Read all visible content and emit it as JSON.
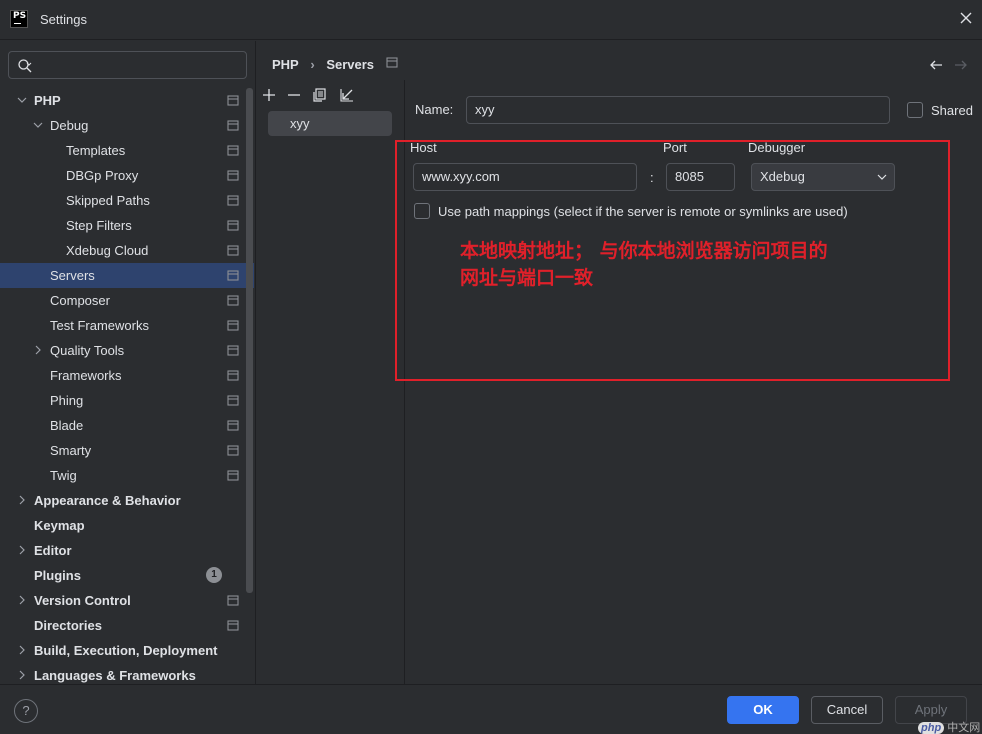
{
  "window": {
    "title": "Settings",
    "logo_text": "PS"
  },
  "search": {
    "placeholder": ""
  },
  "sidebar": {
    "items": [
      {
        "label": "PHP",
        "bold": true,
        "expanded": true
      },
      {
        "label": "Debug",
        "expanded": true
      },
      {
        "label": "Templates"
      },
      {
        "label": "DBGp Proxy"
      },
      {
        "label": "Skipped Paths"
      },
      {
        "label": "Step Filters"
      },
      {
        "label": "Xdebug Cloud"
      },
      {
        "label": "Servers",
        "selected": true
      },
      {
        "label": "Composer"
      },
      {
        "label": "Test Frameworks"
      },
      {
        "label": "Quality Tools"
      },
      {
        "label": "Frameworks"
      },
      {
        "label": "Phing"
      },
      {
        "label": "Blade"
      },
      {
        "label": "Smarty"
      },
      {
        "label": "Twig"
      },
      {
        "label": "Appearance & Behavior",
        "bold": true
      },
      {
        "label": "Keymap",
        "bold": true
      },
      {
        "label": "Editor",
        "bold": true
      },
      {
        "label": "Plugins",
        "bold": true,
        "badge": "1"
      },
      {
        "label": "Version Control",
        "bold": true
      },
      {
        "label": "Directories",
        "bold": true
      },
      {
        "label": "Build, Execution, Deployment",
        "bold": true
      },
      {
        "label": "Languages & Frameworks",
        "bold": true
      }
    ]
  },
  "breadcrumb": {
    "parent": "PHP",
    "separator": "›",
    "current": "Servers"
  },
  "servers": {
    "items": [
      {
        "label": "xyy"
      }
    ]
  },
  "form": {
    "name_label": "Name:",
    "name_value": "xyy",
    "shared_label": "Shared",
    "host_label": "Host",
    "host_value": "www.xyy.com",
    "colon": ":",
    "port_label": "Port",
    "port_value": "8085",
    "debugger_label": "Debugger",
    "debugger_value": "Xdebug",
    "mappings_label": "Use path mappings (select if the server is remote or symlinks are used)"
  },
  "annotation": {
    "line1": "本地映射地址； 与你本地浏览器访问项目的",
    "line2": "网址与端口一致",
    "color": "#e0202a"
  },
  "footer": {
    "help": "?",
    "ok": "OK",
    "cancel": "Cancel",
    "apply": "Apply"
  },
  "watermark": {
    "brand": "php",
    "site": "中文网"
  },
  "colors": {
    "accent": "#3574f0",
    "selection": "#2e436e",
    "background": "#2b2d30"
  }
}
